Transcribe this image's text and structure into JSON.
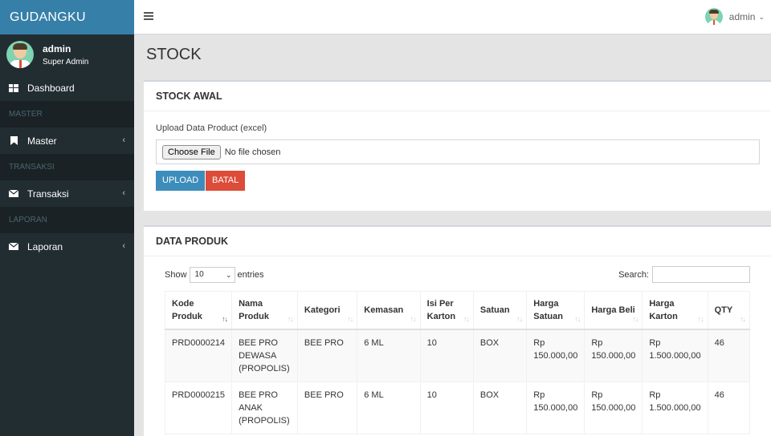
{
  "brand": "GUDANGKU",
  "user": {
    "name": "admin",
    "role": "Super Admin"
  },
  "nav": {
    "dashboard": "Dashboard",
    "header_master": "MASTER",
    "master": "Master",
    "header_transaksi": "TRANSAKSI",
    "transaksi": "Transaksi",
    "header_laporan": "LAPORAN",
    "laporan": "Laporan"
  },
  "topbar": {
    "user_name": "admin"
  },
  "page": {
    "title": "STOCK"
  },
  "stock_awal": {
    "title": "STOCK AWAL",
    "upload_label": "Upload Data Product (excel)",
    "file_button": "Choose File",
    "file_status": "No file chosen",
    "upload_button": "UPLOAD",
    "cancel_button": "BATAL"
  },
  "data_produk": {
    "title": "DATA PRODUK",
    "show_label": "Show",
    "page_length": "10",
    "entries_label": "entries",
    "search_label": "Search:",
    "columns": [
      "Kode Produk",
      "Nama Produk",
      "Kategori",
      "Kemasan",
      "Isi Per Karton",
      "Satuan",
      "Harga Satuan",
      "Harga Beli",
      "Harga Karton",
      "QTY"
    ],
    "rows": [
      [
        "PRD0000214",
        "BEE PRO DEWASA (PROPOLIS)",
        "BEE PRO",
        "6 ML",
        "10",
        "BOX",
        "Rp 150.000,00",
        "Rp 150.000,00",
        "Rp 1.500.000,00",
        "46"
      ],
      [
        "PRD0000215",
        "BEE PRO ANAK (PROPOLIS)",
        "BEE PRO",
        "6 ML",
        "10",
        "BOX",
        "Rp 150.000,00",
        "Rp 150.000,00",
        "Rp 1.500.000,00",
        "46"
      ]
    ]
  },
  "colors": {
    "brand": "#367fa9",
    "sidebar": "#222d32",
    "primary": "#3c8dbc",
    "danger": "#dd4b39"
  }
}
